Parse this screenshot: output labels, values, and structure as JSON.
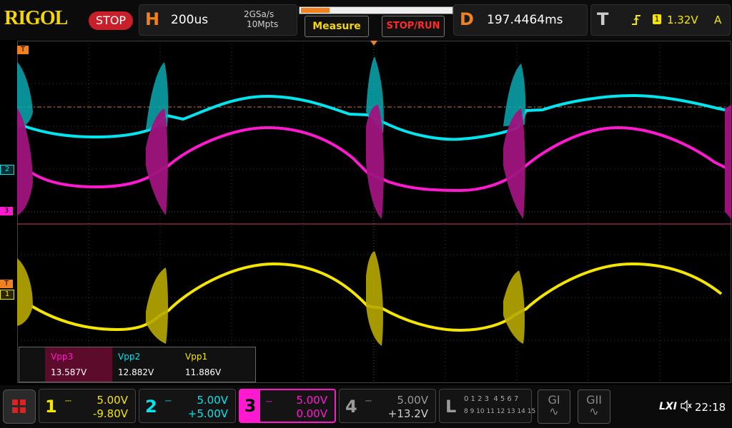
{
  "brand": "RIGOL",
  "run_state": "STOP",
  "horizontal": {
    "letter": "H",
    "timebase": "200us",
    "sample_rate": "2GSa/s",
    "memory_depth": "10Mpts"
  },
  "buttons": {
    "measure": "Measure",
    "stop_run": "STOP/RUN"
  },
  "delay": {
    "letter": "D",
    "value": "197.4464ms"
  },
  "trigger": {
    "letter": "T",
    "source_channel": "1",
    "level": "1.32V",
    "mode": "A"
  },
  "markers": {
    "trigger_top": "T",
    "ch2": "2",
    "ch3": "3",
    "trigger_level": "T",
    "ch1": "1"
  },
  "measurements": [
    {
      "name": "Vpp3",
      "value": "13.587V",
      "color": "#ff1ad0"
    },
    {
      "name": "Vpp2",
      "value": "12.882V",
      "color": "#00e5ee"
    },
    {
      "name": "Vpp1",
      "value": "11.886V",
      "color": "#f4e600"
    }
  ],
  "channels": [
    {
      "num": "1",
      "scale": "5.00V",
      "offset": "-9.80V",
      "color": "#f4e600",
      "active": false
    },
    {
      "num": "2",
      "scale": "5.00V",
      "offset": "+5.00V",
      "color": "#00e5ee",
      "active": false
    },
    {
      "num": "3",
      "scale": "5.00V",
      "offset": "0.00V",
      "color": "#ff1ad0",
      "active": true
    },
    {
      "num": "4",
      "scale": "5.00V",
      "offset": "+13.2V",
      "color": "#9a9a9a",
      "active": false
    }
  ],
  "logic": {
    "letter": "L",
    "row1": "0 1 2 3  4 5 6 7",
    "row2": "8 9 10 11 12 13 14 15"
  },
  "generators": {
    "g1": "GI",
    "g2": "GII"
  },
  "status": {
    "lxi": "LXI",
    "clock": "22:18"
  }
}
